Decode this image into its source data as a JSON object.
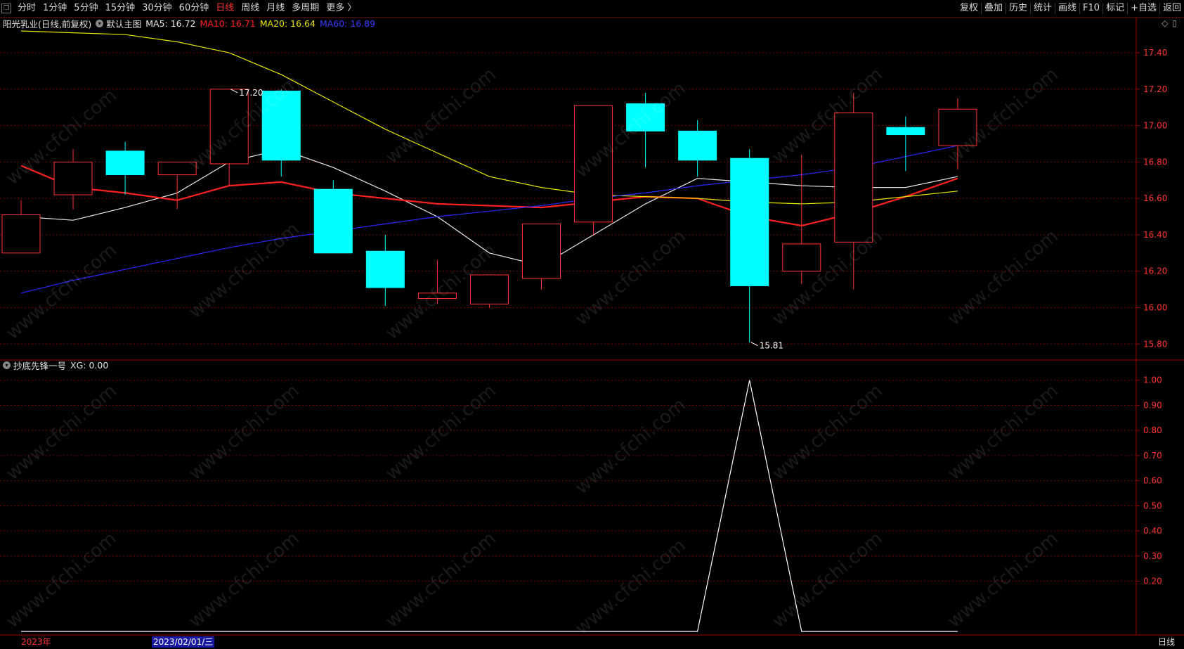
{
  "toolbar": {
    "corner_icon": "❒",
    "periods": [
      {
        "label": "分时",
        "active": false
      },
      {
        "label": "1分钟",
        "active": false
      },
      {
        "label": "5分钟",
        "active": false
      },
      {
        "label": "15分钟",
        "active": false
      },
      {
        "label": "30分钟",
        "active": false
      },
      {
        "label": "60分钟",
        "active": false
      },
      {
        "label": "日线",
        "active": true
      },
      {
        "label": "周线",
        "active": false
      },
      {
        "label": "月线",
        "active": false
      },
      {
        "label": "多周期",
        "active": false
      },
      {
        "label": "更多 〉",
        "active": false
      }
    ],
    "right_items": [
      "复权",
      "叠加",
      "历史",
      "统计",
      "画线",
      "F10",
      "标记",
      "+自选",
      "返回"
    ]
  },
  "main_info": {
    "stock": "阳光乳业(日线,前复权)",
    "template": "默认主图",
    "ma5": "MA5: 16.72",
    "ma10": "MA10: 16.71",
    "ma20": "MA20: 16.64",
    "ma60": "MA60: 16.89"
  },
  "indicator_info": {
    "name": "抄底先锋一号",
    "value": "XG: 0.00"
  },
  "right_icons": [
    "◇",
    "▯"
  ],
  "bottom": {
    "year_label": "2023年",
    "cursor_date": "2023/02/01/三",
    "period_label": "日线"
  },
  "watermark_text": "www.cfchi.com",
  "colors": {
    "up": "#ff3333",
    "down": "#00ffff",
    "ma5": "#e8e8e8",
    "ma10": "#ff2020",
    "ma20": "#e6e600",
    "ma60": "#2a2aff",
    "grid": "#7a0000",
    "axis": "#aa0000",
    "indicator_line": "#ffffff"
  },
  "chart_data": [
    {
      "type": "candlestick",
      "name": "阳光乳业 日线",
      "ylim": [
        15.72,
        17.52
      ],
      "y_ticks": [
        15.8,
        16.0,
        16.2,
        16.4,
        16.6,
        16.8,
        17.0,
        17.2,
        17.4
      ],
      "y_tick_labels": [
        "15.80",
        "16.00",
        "16.20",
        "16.40",
        "16.60",
        "16.80",
        "17.00",
        "17.20",
        "17.40"
      ],
      "grid": true,
      "candles": [
        {
          "open": 16.3,
          "close": 16.51,
          "high": 16.59,
          "low": 16.3
        },
        {
          "open": 16.62,
          "close": 16.8,
          "high": 16.87,
          "low": 16.54
        },
        {
          "open": 16.86,
          "close": 16.73,
          "high": 16.91,
          "low": 16.62
        },
        {
          "open": 16.73,
          "close": 16.8,
          "high": 16.8,
          "low": 16.54
        },
        {
          "open": 16.79,
          "close": 17.2,
          "high": 17.2,
          "low": 16.67
        },
        {
          "open": 17.19,
          "close": 16.81,
          "high": 17.2,
          "low": 16.72
        },
        {
          "open": 16.65,
          "close": 16.3,
          "high": 16.7,
          "low": 16.3
        },
        {
          "open": 16.31,
          "close": 16.11,
          "high": 16.4,
          "low": 16.01
        },
        {
          "open": 16.05,
          "close": 16.08,
          "high": 16.26,
          "low": 16.02
        },
        {
          "open": 16.02,
          "close": 16.18,
          "high": 16.18,
          "low": 16.0
        },
        {
          "open": 16.16,
          "close": 16.46,
          "high": 16.46,
          "low": 16.1
        },
        {
          "open": 16.47,
          "close": 17.11,
          "high": 17.11,
          "low": 16.4
        },
        {
          "open": 17.12,
          "close": 16.97,
          "high": 17.18,
          "low": 16.77
        },
        {
          "open": 16.97,
          "close": 16.81,
          "high": 17.03,
          "low": 16.72
        },
        {
          "open": 16.82,
          "close": 16.12,
          "high": 16.87,
          "low": 15.81
        },
        {
          "open": 16.2,
          "close": 16.35,
          "high": 16.84,
          "low": 16.13
        },
        {
          "open": 16.36,
          "close": 17.07,
          "high": 17.18,
          "low": 16.1
        },
        {
          "open": 16.99,
          "close": 16.95,
          "high": 17.05,
          "low": 16.75
        },
        {
          "open": 16.89,
          "close": 17.09,
          "high": 17.15,
          "low": 16.76
        }
      ],
      "annotations": [
        {
          "text": "17.20",
          "index": 4,
          "value": 17.2
        },
        {
          "text": "15.81",
          "index": 14,
          "value": 15.81
        }
      ],
      "series": [
        {
          "name": "MA5",
          "values": [
            16.5,
            16.48,
            16.55,
            16.63,
            16.8,
            16.87,
            16.77,
            16.64,
            16.5,
            16.3,
            16.23,
            16.4,
            16.57,
            16.71,
            16.69,
            16.67,
            16.66,
            16.66,
            16.72
          ]
        },
        {
          "name": "MA10",
          "values": [
            16.78,
            16.66,
            16.63,
            16.59,
            16.67,
            16.69,
            16.63,
            16.6,
            16.57,
            16.56,
            16.55,
            16.58,
            16.61,
            16.6,
            16.5,
            16.45,
            16.52,
            16.61,
            16.71
          ]
        },
        {
          "name": "MA20",
          "values": [
            17.52,
            17.51,
            17.5,
            17.46,
            17.4,
            17.28,
            17.13,
            16.98,
            16.85,
            16.72,
            16.66,
            16.62,
            16.61,
            16.6,
            16.58,
            16.57,
            16.58,
            16.61,
            16.64
          ]
        },
        {
          "name": "MA60",
          "values": [
            16.08,
            16.15,
            16.21,
            16.27,
            16.33,
            16.38,
            16.42,
            16.46,
            16.5,
            16.53,
            16.56,
            16.6,
            16.63,
            16.67,
            16.7,
            16.73,
            16.77,
            16.83,
            16.89
          ]
        }
      ]
    },
    {
      "type": "line",
      "name": "抄底先锋一号",
      "ylim": [
        0.0,
        1.03
      ],
      "y_ticks": [
        0.2,
        0.3,
        0.4,
        0.5,
        0.6,
        0.7,
        0.8,
        0.9,
        1.0
      ],
      "y_tick_labels": [
        "0.20",
        "0.30",
        "0.40",
        "0.50",
        "0.60",
        "0.70",
        "0.80",
        "0.90",
        "1.00"
      ],
      "grid": true,
      "series": [
        {
          "name": "XG",
          "values": [
            0,
            0,
            0,
            0,
            0,
            0,
            0,
            0,
            0,
            0,
            0,
            0,
            0,
            0,
            1,
            0,
            0,
            0,
            0
          ]
        }
      ]
    }
  ]
}
